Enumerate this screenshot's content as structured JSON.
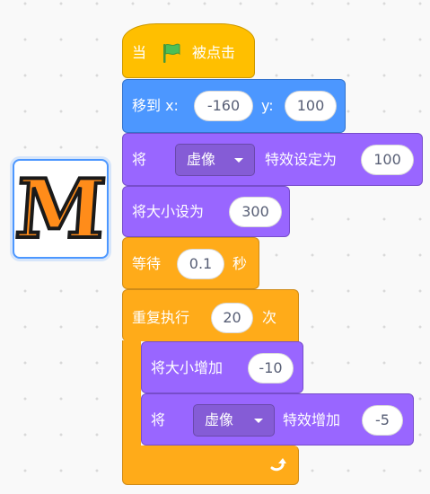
{
  "sprite": {
    "letter": "M",
    "selected": true
  },
  "blocks": {
    "when_flag": {
      "pre": "当",
      "post": "被点击"
    },
    "goto": {
      "label": "移到 x:",
      "x": "-160",
      "y_label": "y:",
      "y": "100"
    },
    "set_effect": {
      "pre": "将",
      "effect": "虚像",
      "post": "特效设定为",
      "value": "100"
    },
    "set_size": {
      "label": "将大小设为",
      "value": "300"
    },
    "wait": {
      "label": "等待",
      "value": "0.1",
      "unit": "秒"
    },
    "repeat": {
      "label": "重复执行",
      "value": "20",
      "unit": "次"
    },
    "change_size": {
      "label": "将大小增加",
      "value": "-10"
    },
    "change_effect": {
      "pre": "将",
      "effect": "虚像",
      "post": "特效增加",
      "value": "-5"
    }
  },
  "colors": {
    "events": "#ffbf00",
    "motion": "#4c97ff",
    "looks": "#9966ff",
    "control": "#ffab19",
    "flag": "#4cbf56"
  }
}
